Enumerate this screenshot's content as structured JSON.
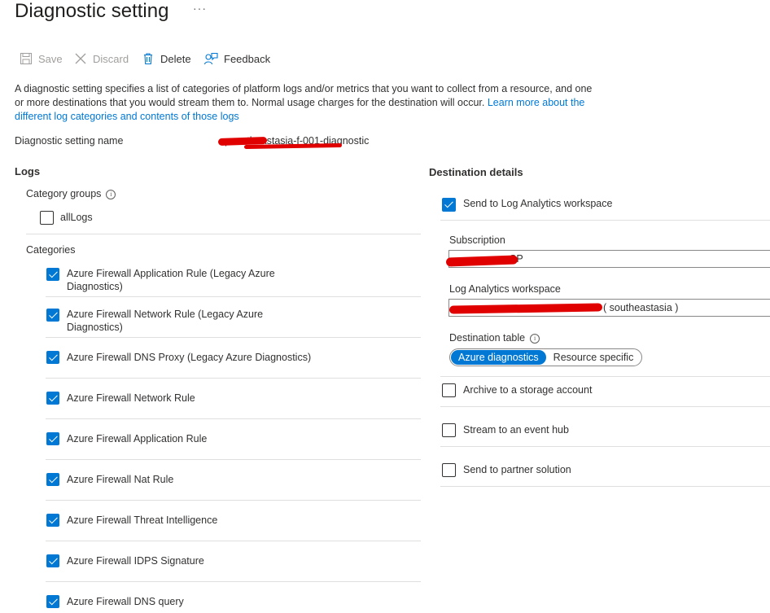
{
  "page": {
    "title": "Diagnostic setting",
    "more": "···"
  },
  "toolbar": {
    "save": "Save",
    "discard": "Discard",
    "delete": "Delete",
    "feedback": "Feedback"
  },
  "description": {
    "text": "A diagnostic setting specifies a list of categories of platform logs and/or metrics that you want to collect from a resource, and one or more destinations that you would stream them to. Normal usage charges for the destination will occur.",
    "link": "Learn more about the different log categories and contents of those logs"
  },
  "setting_name": {
    "label": "Diagnostic setting name",
    "value": "-psoutheastasia-f-001-diagnostic"
  },
  "logs": {
    "heading": "Logs",
    "category_groups_label": "Category groups",
    "groups": [
      {
        "label": "allLogs",
        "checked": false
      }
    ],
    "categories_label": "Categories",
    "categories": [
      {
        "label": "Azure Firewall Application Rule (Legacy Azure Diagnostics)",
        "checked": true
      },
      {
        "label": "Azure Firewall Network Rule (Legacy Azure Diagnostics)",
        "checked": true
      },
      {
        "label": "Azure Firewall DNS Proxy (Legacy Azure Diagnostics)",
        "checked": true
      },
      {
        "label": "Azure Firewall Network Rule",
        "checked": true
      },
      {
        "label": "Azure Firewall Application Rule",
        "checked": true
      },
      {
        "label": "Azure Firewall Nat Rule",
        "checked": true
      },
      {
        "label": "Azure Firewall Threat Intelligence",
        "checked": true
      },
      {
        "label": "Azure Firewall IDPS Signature",
        "checked": true
      },
      {
        "label": "Azure Firewall DNS query",
        "checked": true
      }
    ]
  },
  "destination": {
    "heading": "Destination details",
    "send_log_analytics": {
      "label": "Send to Log Analytics workspace",
      "checked": true
    },
    "subscription": {
      "label": "Subscription",
      "value": "SP"
    },
    "workspace": {
      "label": "Log Analytics workspace",
      "value": "( southeastasia )"
    },
    "destination_table": {
      "label": "Destination table",
      "options": [
        "Azure diagnostics",
        "Resource specific"
      ],
      "selected": "Azure diagnostics"
    },
    "archive": {
      "label": "Archive to a storage account",
      "checked": false
    },
    "event_hub": {
      "label": "Stream to an event hub",
      "checked": false
    },
    "partner": {
      "label": "Send to partner solution",
      "checked": false
    }
  },
  "colors": {
    "accent": "#0078d4",
    "redaction": "#e00000",
    "text": "#323130",
    "disabled": "#a19f9d"
  }
}
